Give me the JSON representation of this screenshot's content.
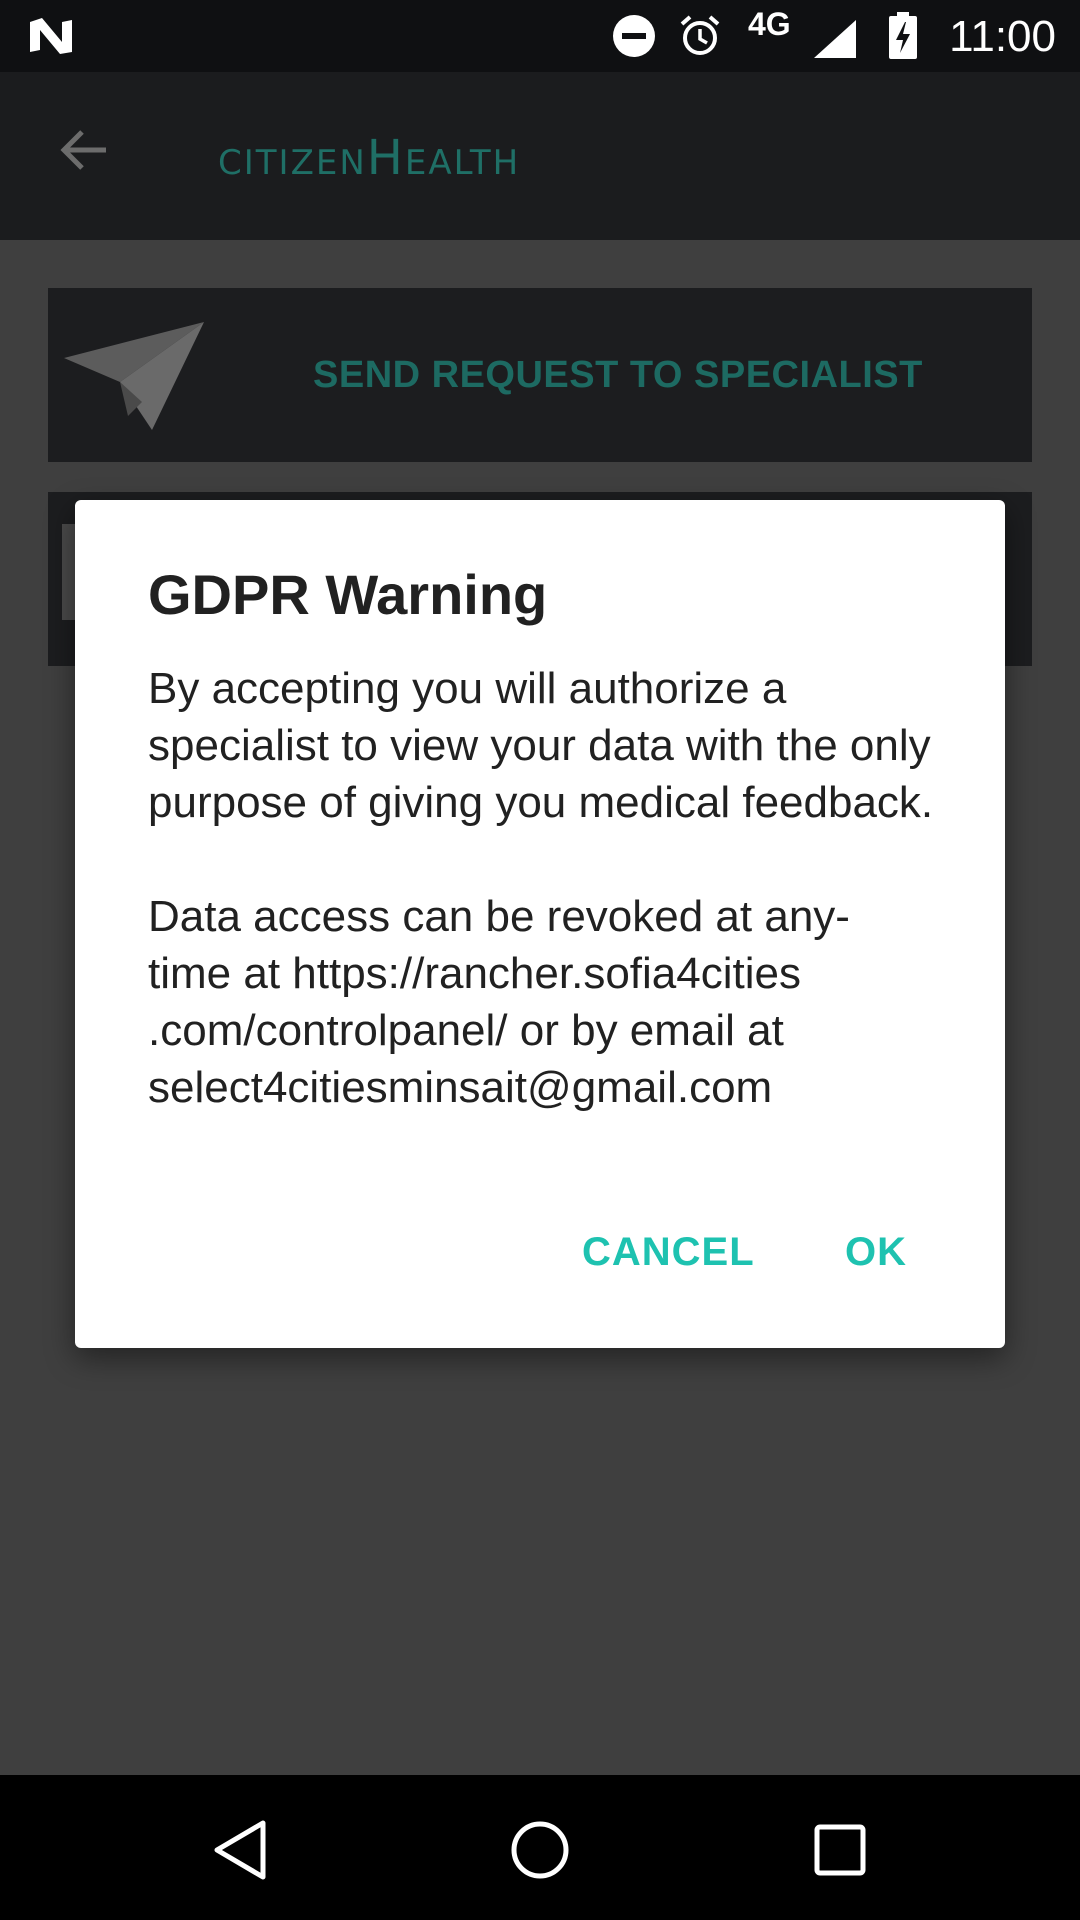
{
  "status_bar": {
    "network_type": "4G",
    "time": "11:00",
    "icons": [
      "n-logo-icon",
      "do-not-disturb-icon",
      "alarm-icon",
      "signal-icon",
      "battery-charging-icon"
    ]
  },
  "app_bar": {
    "title": "citizenHealth",
    "back_icon": "arrow-back-icon"
  },
  "content": {
    "send_request_label": "SEND REQUEST TO SPECIALIST",
    "send_icon": "paper-plane-icon"
  },
  "dialog": {
    "title": "GDPR Warning",
    "paragraph_1": "By accepting you will authorize a specialist to view your data with the only purpose of giving you medical feedback.",
    "paragraph_2_lines": [
      "Data access can be revoked at any-",
      "time at https://rancher.sofia4cities",
      ".com/controlpanel/ or by email at",
      "select4citiesminsait@gmail.com"
    ],
    "cancel_label": "CANCEL",
    "ok_label": "OK"
  },
  "nav_bar": {
    "icons": [
      "back-triangle-icon",
      "home-circle-icon",
      "recents-square-icon"
    ]
  },
  "colors": {
    "accent": "#1ec2b0",
    "brand_dim": "#1f6f66",
    "scrim": "#3f3f3f"
  }
}
